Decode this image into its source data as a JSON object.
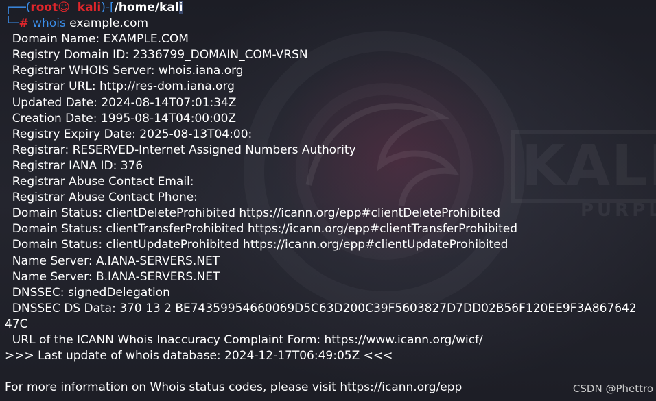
{
  "prompt": {
    "box_top": "┌──(",
    "user": "root",
    "skull": "☺",
    "host": "kali",
    "bracket_mid": ")-[",
    "path": "/home/kal",
    "cursor_char": "i",
    "box_bottom": "└─",
    "hash": "#",
    "command": "whois",
    "argument": "example.com"
  },
  "output": [
    "  Domain Name: EXAMPLE.COM",
    "  Registry Domain ID: 2336799_DOMAIN_COM-VRSN",
    "  Registrar WHOIS Server: whois.iana.org",
    "  Registrar URL: http://res-dom.iana.org",
    "  Updated Date: 2024-08-14T07:01:34Z",
    "  Creation Date: 1995-08-14T04:00:00Z",
    "  Registry Expiry Date: 2025-08-13T04:00:",
    "  Registrar: RESERVED-Internet Assigned Numbers Authority",
    "  Registrar IANA ID: 376",
    "  Registrar Abuse Contact Email:",
    "  Registrar Abuse Contact Phone:",
    "  Domain Status: clientDeleteProhibited https://icann.org/epp#clientDeleteProhibited",
    "  Domain Status: clientTransferProhibited https://icann.org/epp#clientTransferProhibited",
    "  Domain Status: clientUpdateProhibited https://icann.org/epp#clientUpdateProhibited",
    "  Name Server: A.IANA-SERVERS.NET",
    "  Name Server: B.IANA-SERVERS.NET",
    "  DNSSEC: signedDelegation",
    "  DNSSEC DS Data: 370 13 2 BE74359954660069D5C63D200C39F5603827D7DD02B56F120EE9F3A867642",
    "47C",
    "  URL of the ICANN Whois Inaccuracy Complaint Form: https://www.icann.org/wicf/",
    ">>> Last update of whois database: 2024-12-17T06:49:05Z <<<",
    "",
    "For more information on Whois status codes, please visit https://icann.org/epp"
  ],
  "wallpaper": {
    "logo_text": "KALI",
    "logo_subtext": "PURPLE"
  },
  "watermark": "CSDN @Phettro",
  "colors": {
    "prompt_blue": "#3b8eea",
    "prompt_red": "#e0262b",
    "background": "#20212a"
  }
}
